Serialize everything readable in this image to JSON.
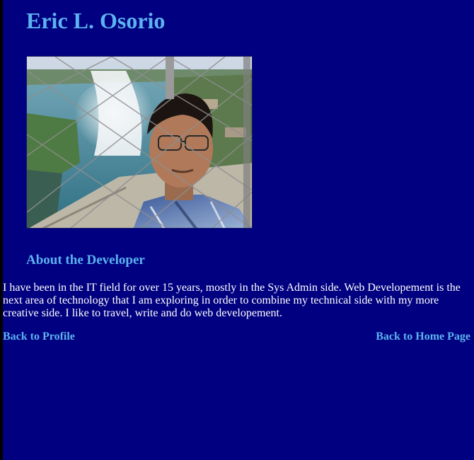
{
  "header": {
    "title": "Eric L. Osorio"
  },
  "photo": {
    "alt": "Portrait photo in front of a waterfall",
    "icon": "portrait-photo"
  },
  "about": {
    "heading": "About the Developer",
    "text": "I have been in the IT field for over 15 years, mostly in the Sys Admin side. Web Developement is the next area of technology that I am exploring in order to combine my technical side with my more creative side. I like to travel, write and do web developement."
  },
  "links": {
    "back_to_profile": "Back to Profile",
    "back_to_home": "Back to Home Page"
  },
  "colors": {
    "background": "#000080",
    "heading": "#5cb3f0",
    "text": "#ffffff"
  }
}
